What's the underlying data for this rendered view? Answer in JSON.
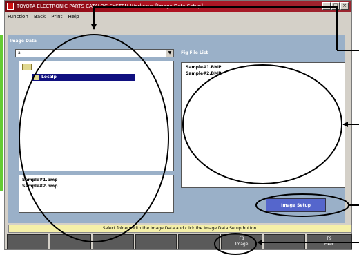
{
  "window": {
    "title": "TOYOTA ELECTRONIC PARTS CATALOG SYSTEM  Worksave  [Image Data Setup]"
  },
  "menu": {
    "items": [
      "Function",
      "Back",
      "Print",
      "Help"
    ]
  },
  "image_data": {
    "section_title": "Image Data",
    "drive_value": "a:",
    "folder_label": "Localp",
    "files": [
      "Sample#1.bmp",
      "Sample#2.bmp"
    ]
  },
  "fig_file_list": {
    "label": "Fig File List",
    "items": [
      "Sample#1.BMP",
      "Sample#2.BMP"
    ]
  },
  "buttons": {
    "image_setup": "Image Setup"
  },
  "status": {
    "message": "Select folders with the Image Data and click the Image Data Setup button."
  },
  "function_keys": [
    {
      "top": "",
      "bottom": ""
    },
    {
      "top": "",
      "bottom": ""
    },
    {
      "top": "",
      "bottom": ""
    },
    {
      "top": "",
      "bottom": ""
    },
    {
      "top": "",
      "bottom": ""
    },
    {
      "top": "F8",
      "bottom": "Image"
    },
    {
      "top": "",
      "bottom": ""
    },
    {
      "top": "F9",
      "bottom": "Exec"
    }
  ],
  "colors": {
    "titlebar": "#b01020",
    "content_bg": "#9ab0c8",
    "status_bg": "#f5f0a8",
    "button": "#5566cc",
    "annotation": "#000000"
  }
}
